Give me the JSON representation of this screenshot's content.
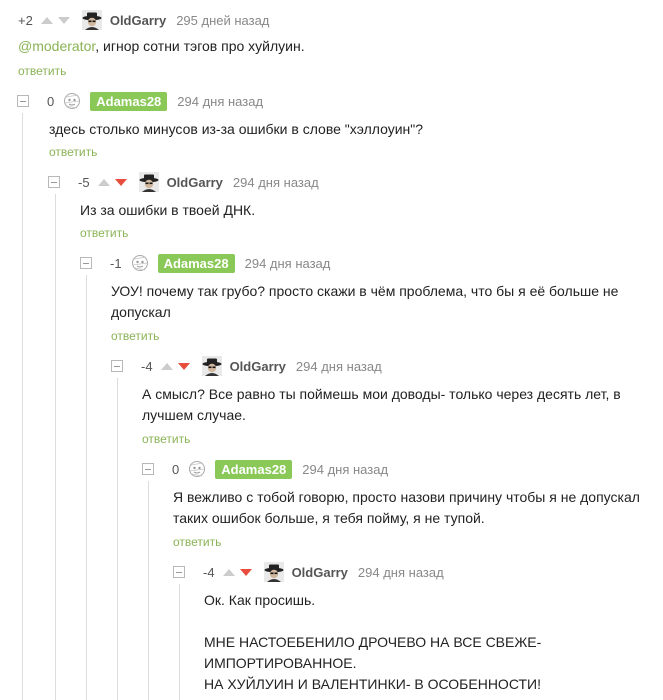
{
  "comments": [
    {
      "rating": "+2",
      "author": "OldGarry",
      "time": "295 дней назад",
      "mention": "@moderator",
      "text_rest": ", игнор сотни тэгов про хуйлуин.",
      "reply": "ответить"
    },
    {
      "rating": "0",
      "author": "Adamas28",
      "time": "294 дня назад",
      "text": "здесь столько минусов из-за ошибки в слове \"хэллоуин\"?",
      "reply": "ответить"
    },
    {
      "rating": "-5",
      "author": "OldGarry",
      "time": "294 дня назад",
      "text": "Из за ошибки в твоей ДНК.",
      "reply": "ответить"
    },
    {
      "rating": "-1",
      "author": "Adamas28",
      "time": "294 дня назад",
      "text": "УОУ! почему так грубо? просто скажи в чём проблема, что бы я её больше не допускал",
      "reply": "ответить"
    },
    {
      "rating": "-4",
      "author": "OldGarry",
      "time": "294 дня назад",
      "text": "А смысл? Все равно ты поймешь мои доводы- только через десять лет, в лучшем случае.",
      "reply": "ответить"
    },
    {
      "rating": "0",
      "author": "Adamas28",
      "time": "294 дня назад",
      "text": "Я вежливо с тобой говорю, просто назови причину чтобы я не допускал таких ошибок больше, я тебя пойму, я не тупой.",
      "reply": "ответить"
    },
    {
      "rating": "-4",
      "author": "OldGarry",
      "time": "294 дня назад",
      "line1": "Ок. Как просишь.",
      "line2": "МНЕ НАСТОЕБЕНИЛО ДРОЧЕВО НА ВСЕ СВЕЖЕ-",
      "line3": "ИМПОРТИРОВАННОЕ.",
      "line4": "НА ХУЙЛУИН И ВАЛЕНТИНКИ- В ОСОБЕННОСТИ!"
    }
  ],
  "colors": {
    "accent_green": "#8ab356",
    "author_badge": "#8ac858",
    "downvote_active": "#e74c3c",
    "vote_inactive": "#cccccc"
  },
  "icons": {
    "avatar_oldgarry": "cowboy-hat-avatar",
    "avatar_adamas": "sketch-face-avatar",
    "collapse": "collapse-minus-icon"
  }
}
